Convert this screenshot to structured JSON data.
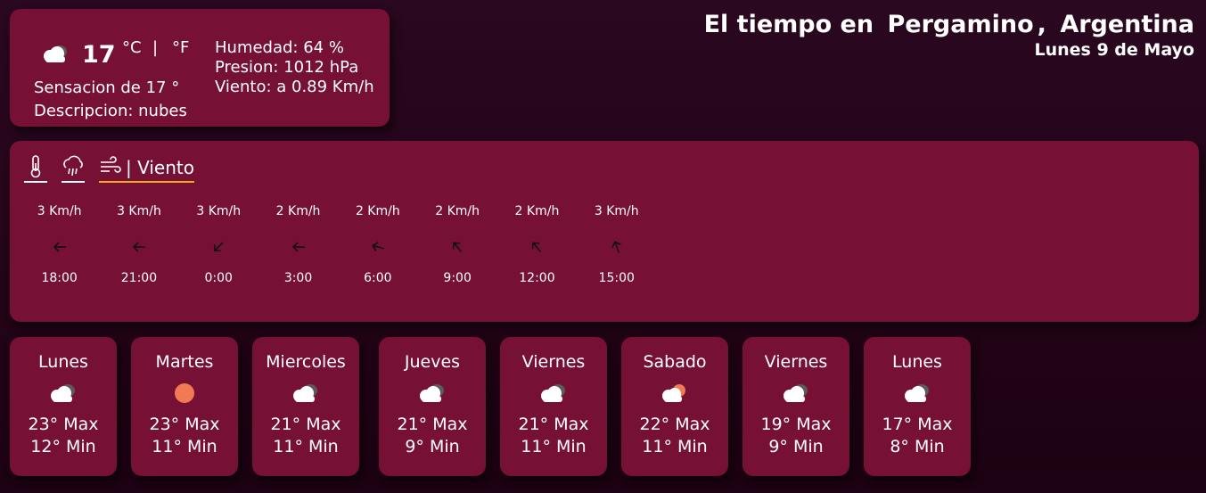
{
  "header": {
    "prefix": "El tiempo en",
    "city": "Pergamino",
    "comma": ",",
    "country": "Argentina",
    "date": "Lunes 9 de Mayo"
  },
  "current": {
    "icon": "cloud-icon",
    "temp": "17",
    "unit_c": "°C",
    "unit_sep": "|",
    "unit_f": "°F",
    "feels_like": "Sensacion de 17 °",
    "description": "Descripcion: nubes",
    "humidity": "Humedad: 64 %",
    "pressure": "Presion: 1012 hPa",
    "wind": "Viento: a 0.89 Km/h"
  },
  "tabs": {
    "active_label": "| Viento",
    "icons": [
      "thermometer-icon",
      "rain-cloud-icon",
      "wind-icon"
    ]
  },
  "hourly": [
    {
      "speed": "3 Km/h",
      "time": "18:00",
      "dir_deg": 270
    },
    {
      "speed": "3 Km/h",
      "time": "21:00",
      "dir_deg": 272
    },
    {
      "speed": "3 Km/h",
      "time": "0:00",
      "dir_deg": 225
    },
    {
      "speed": "2 Km/h",
      "time": "3:00",
      "dir_deg": 272
    },
    {
      "speed": "2 Km/h",
      "time": "6:00",
      "dir_deg": 285
    },
    {
      "speed": "2 Km/h",
      "time": "9:00",
      "dir_deg": 320
    },
    {
      "speed": "2 Km/h",
      "time": "12:00",
      "dir_deg": 320
    },
    {
      "speed": "3 Km/h",
      "time": "15:00",
      "dir_deg": 340
    }
  ],
  "daily": [
    {
      "day": "Lunes",
      "icon": "cloud-icon",
      "max": "23° Max",
      "min": "12° Min"
    },
    {
      "day": "Martes",
      "icon": "sun-icon",
      "max": "23° Max",
      "min": "11° Min"
    },
    {
      "day": "Miercoles",
      "icon": "cloud-icon",
      "max": "21° Max",
      "min": "11° Min"
    },
    {
      "day": "Jueves",
      "icon": "cloud-icon",
      "max": "21° Max",
      "min": "9° Min"
    },
    {
      "day": "Viernes",
      "icon": "cloud-icon",
      "max": "21° Max",
      "min": "11° Min"
    },
    {
      "day": "Sabado",
      "icon": "partly-cloudy-icon",
      "max": "22° Max",
      "min": "11° Min"
    },
    {
      "day": "Viernes",
      "icon": "cloud-icon",
      "max": "19° Max",
      "min": "9° Min"
    },
    {
      "day": "Lunes",
      "icon": "cloud-icon",
      "max": "17° Max",
      "min": "8° Min"
    }
  ],
  "colors": {
    "background": "#220417",
    "card": "#771035",
    "accent_underline": "#f5a623",
    "sun": "#ef7a54"
  }
}
